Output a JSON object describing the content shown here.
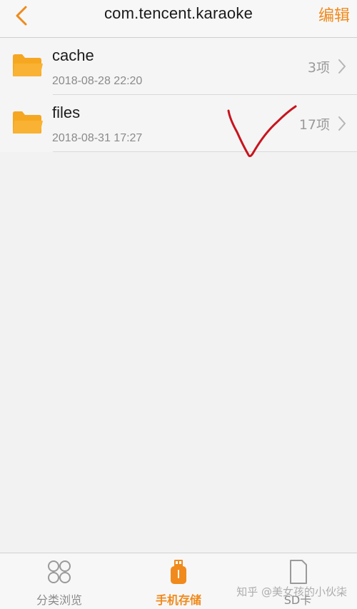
{
  "header": {
    "title": "com.tencent.karaoke",
    "edit_label": "编辑",
    "accent_color": "#f08a1c"
  },
  "files": [
    {
      "name": "cache",
      "date": "2018-08-28 22:20",
      "count": "3项",
      "icon": "folder-icon"
    },
    {
      "name": "files",
      "date": "2018-08-31 17:27",
      "count": "17项",
      "icon": "folder-icon"
    }
  ],
  "bottom_nav": {
    "items": [
      {
        "label": "分类浏览",
        "icon": "category-grid-icon",
        "active": false
      },
      {
        "label": "手机存储",
        "icon": "phone-storage-icon",
        "active": true
      },
      {
        "label": "SD卡",
        "icon": "sd-card-icon",
        "active": false
      }
    ]
  },
  "watermark": "知乎 @美女孩的小伙柒",
  "annotation": {
    "type": "red-check-mark",
    "color": "#c8141e"
  }
}
